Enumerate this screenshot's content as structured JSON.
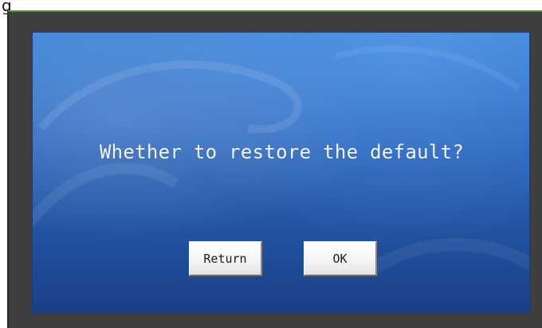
{
  "page": {
    "top_fragment": "g"
  },
  "dialog": {
    "message": "Whether to restore the default?",
    "buttons": {
      "return_label": "Return",
      "ok_label": "OK"
    }
  },
  "colors": {
    "screen_top": "#3f86d9",
    "screen_bottom": "#1a3f86",
    "frame": "#3e3e3e",
    "frame_top_accent": "#4f8f3a",
    "text": "#f2f6ff"
  }
}
